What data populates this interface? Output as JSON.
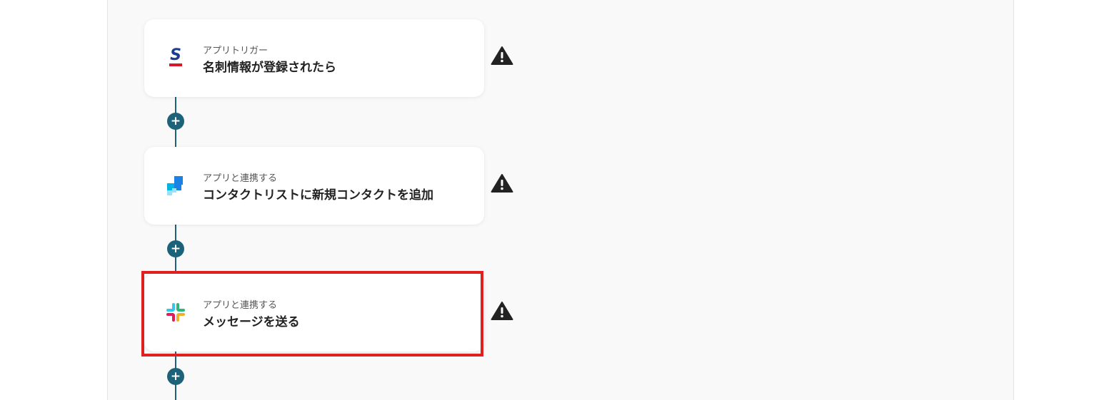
{
  "flow": {
    "steps": [
      {
        "caption": "アプリトリガー",
        "title": "名刺情報が登録されたら",
        "icon": "sansan-logo-icon"
      },
      {
        "caption": "アプリと連携する",
        "title": "コンタクトリストに新規コンタクトを追加",
        "icon": "sendgrid-logo-icon"
      },
      {
        "caption": "アプリと連携する",
        "title": "メッセージを送る",
        "icon": "slack-logo-icon"
      }
    ],
    "add_button_symbol": "+",
    "warning_icon": "warning-icon"
  },
  "colors": {
    "connector": "#1c6278",
    "highlight": "#e11f1f",
    "warning": "#222222"
  }
}
